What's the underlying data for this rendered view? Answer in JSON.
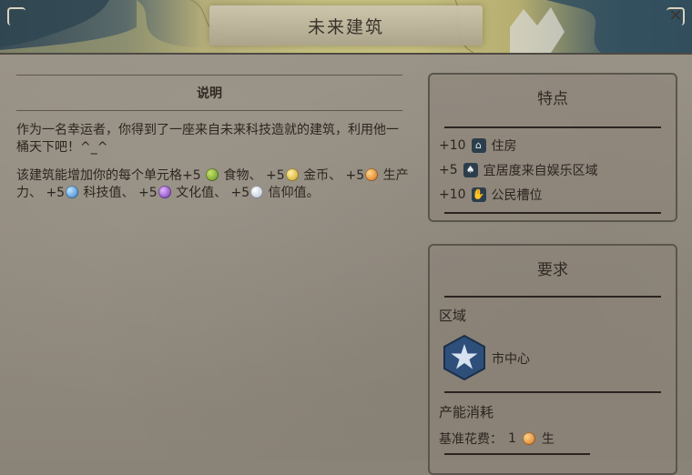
{
  "header": {
    "title": "未来建筑",
    "close_glyph": "✕"
  },
  "description": {
    "heading": "说明",
    "flavor_text": "作为一名幸运者，你得到了一座来自未来科技造就的建筑，利用他一桶天下吧！^_^",
    "effect": {
      "prefix": "该建筑能增加你的每个单元格",
      "items": [
        {
          "amount": "+5",
          "icon": "food-icon",
          "label": "食物",
          "sep": "、"
        },
        {
          "amount": "+5",
          "icon": "gold-icon",
          "label": "金币",
          "sep": "、"
        },
        {
          "amount": "+5",
          "icon": "production-icon",
          "label": "生产力",
          "sep": "、"
        },
        {
          "amount": "+5",
          "icon": "science-icon",
          "label": "科技值",
          "sep": "、"
        },
        {
          "amount": "+5",
          "icon": "culture-icon",
          "label": "文化值",
          "sep": "、"
        },
        {
          "amount": "+5",
          "icon": "faith-icon",
          "label": "信仰值",
          "sep": "。"
        }
      ]
    }
  },
  "features": {
    "title": "特点",
    "rows": [
      {
        "amount": "+10",
        "icon": "housing-icon",
        "label": "住房"
      },
      {
        "amount": "+5",
        "icon": "amenity-icon",
        "label": "宜居度来自娱乐区域"
      },
      {
        "amount": "+10",
        "icon": "citizen-slot-icon",
        "label": "公民槽位"
      }
    ]
  },
  "requirements": {
    "title": "要求",
    "district_label": "区域",
    "district_name": "市中心",
    "district_icon": "city-center-star-icon",
    "cost_label": "产能消耗",
    "base_cost_text": "基准花费：",
    "base_cost_value": "1",
    "base_cost_unit": "生",
    "cost_icon": "production-icon"
  },
  "colors": {
    "panel_border": "#5a554d",
    "text": "#2b2620",
    "map_land": "#c6c07f",
    "map_water": "#3a4d57"
  }
}
